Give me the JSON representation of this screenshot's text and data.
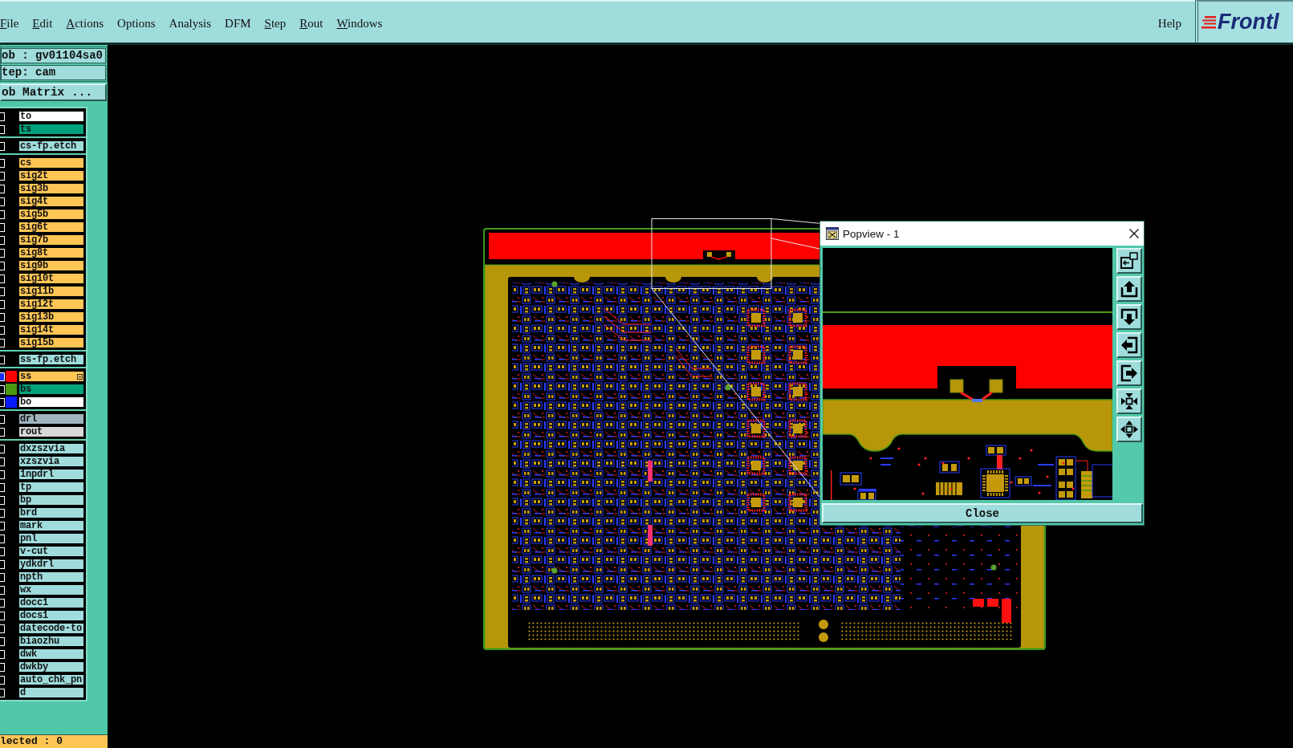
{
  "menu_bar": {
    "items": [
      {
        "label": "File",
        "mnemonic": true
      },
      {
        "label": "Edit",
        "mnemonic": true
      },
      {
        "label": "Actions",
        "mnemonic": true
      },
      {
        "label": "Options",
        "mnemonic": false
      },
      {
        "label": "Analysis",
        "mnemonic": false
      },
      {
        "label": "DFM",
        "mnemonic": false
      },
      {
        "label": "Step",
        "mnemonic": true
      },
      {
        "label": "Rout",
        "mnemonic": true
      },
      {
        "label": "Windows",
        "mnemonic": true
      }
    ],
    "help": "Help",
    "logo": "Frontl"
  },
  "job_panel": {
    "job": "ob : gv01104sa0",
    "step": "tep: cam",
    "matrix_button": "ob Matrix ..."
  },
  "layer_groups": [
    {
      "layers": [
        {
          "name": "to",
          "color": "#ffffff",
          "work": false
        },
        {
          "name": "ts",
          "color": "#00a27c",
          "work": false
        }
      ]
    },
    {
      "layers": [
        {
          "name": "cs-fp.etch",
          "color": "#a0dcdc",
          "work": false
        }
      ]
    },
    {
      "layers": [
        {
          "name": "cs",
          "color": "#ffc655",
          "work": false
        },
        {
          "name": "sig2t",
          "color": "#ffc655",
          "work": false
        },
        {
          "name": "sig3b",
          "color": "#ffc655",
          "work": false
        },
        {
          "name": "sig4t",
          "color": "#ffc655",
          "work": false
        },
        {
          "name": "sig5b",
          "color": "#ffc655",
          "work": false
        },
        {
          "name": "sig6t",
          "color": "#ffc655",
          "work": false
        },
        {
          "name": "sig7b",
          "color": "#ffc655",
          "work": false
        },
        {
          "name": "sig8t",
          "color": "#ffc655",
          "work": false
        },
        {
          "name": "sig9b",
          "color": "#ffc655",
          "work": false
        },
        {
          "name": "sig10t",
          "color": "#ffc655",
          "work": false
        },
        {
          "name": "sig11b",
          "color": "#ffc655",
          "work": false
        },
        {
          "name": "sig12t",
          "color": "#ffc655",
          "work": false
        },
        {
          "name": "sig13b",
          "color": "#ffc655",
          "work": false
        },
        {
          "name": "sig14t",
          "color": "#ffc655",
          "work": false
        },
        {
          "name": "sig15b",
          "color": "#ffc655",
          "work": false
        }
      ]
    },
    {
      "layers": [
        {
          "name": "ss-fp.etch",
          "color": "#a0dcdc",
          "work": false
        }
      ]
    },
    {
      "layers": [
        {
          "name": "ss",
          "color": "#ffc655",
          "work": true,
          "swatch": {
            "color": "#ff0000"
          }
        },
        {
          "name": "bs",
          "color": "#00a27c",
          "work": false,
          "swatch": {
            "color": "#4c9a10"
          }
        },
        {
          "name": "bo",
          "color": "#ffffff",
          "work": false,
          "swatch": {
            "color": "#0a1aff"
          }
        }
      ]
    },
    {
      "layers": [
        {
          "name": "drl",
          "color": "#a0b4be",
          "work": false
        },
        {
          "name": "rout",
          "color": "#d8d8d8",
          "work": false
        }
      ]
    },
    {
      "layers": [
        {
          "name": "dxzszvia",
          "color": "#a0dcdc",
          "work": false
        },
        {
          "name": "xzszvia",
          "color": "#a0dcdc",
          "work": false
        },
        {
          "name": "1npdrl",
          "color": "#a0dcdc",
          "work": false
        },
        {
          "name": "tp",
          "color": "#a0dcdc",
          "work": false
        },
        {
          "name": "bp",
          "color": "#a0dcdc",
          "work": false
        },
        {
          "name": "brd",
          "color": "#a0dcdc",
          "work": false
        },
        {
          "name": "mark",
          "color": "#a0dcdc",
          "work": false
        },
        {
          "name": "pnl",
          "color": "#a0dcdc",
          "work": false
        },
        {
          "name": "v-cut",
          "color": "#a0dcdc",
          "work": false
        },
        {
          "name": "ydkdrl",
          "color": "#a0dcdc",
          "work": false
        },
        {
          "name": "npth",
          "color": "#a0dcdc",
          "work": false
        },
        {
          "name": "wx",
          "color": "#a0dcdc",
          "work": false
        },
        {
          "name": "docc1",
          "color": "#a0dcdc",
          "work": false
        },
        {
          "name": "docs1",
          "color": "#a0dcdc",
          "work": false
        },
        {
          "name": "datecode-to",
          "color": "#a0dcdc",
          "work": false
        },
        {
          "name": "biaozhu",
          "color": "#a0dcdc",
          "work": false
        },
        {
          "name": "dwk",
          "color": "#a0dcdc",
          "work": false
        },
        {
          "name": "dwkby",
          "color": "#a0dcdc",
          "work": false
        },
        {
          "name": "auto_chk_pn",
          "color": "#a0dcdc",
          "work": false
        },
        {
          "name": "d",
          "color": "#a0dcdc",
          "work": false
        }
      ]
    }
  ],
  "status_field": "lected : 0",
  "popview": {
    "title": "Popview - 1",
    "tools": [
      {
        "kind": "window"
      },
      {
        "kind": "up"
      },
      {
        "kind": "down"
      },
      {
        "kind": "left"
      },
      {
        "kind": "right"
      },
      {
        "kind": "inward"
      },
      {
        "kind": "outward"
      }
    ],
    "close_button": "Close"
  }
}
